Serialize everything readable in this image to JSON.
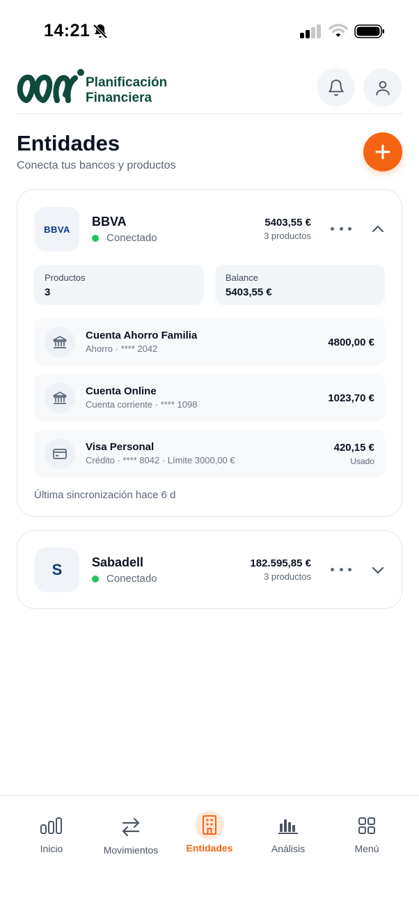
{
  "status_bar": {
    "time": "14:21"
  },
  "header": {
    "app_name_line1": "Planificación",
    "app_name_line2": "Financiera",
    "brand_color": "#0f4a3c"
  },
  "page": {
    "title": "Entidades",
    "subtitle": "Conecta tus bancos y productos",
    "accent_color": "#f56412"
  },
  "banks": [
    {
      "logo_text": "BBVA",
      "name": "BBVA",
      "status": "Conectado",
      "total": "5403,55 €",
      "count": "3 productos",
      "expanded": true,
      "stats": {
        "products_label": "Productos",
        "products_value": "3",
        "balance_label": "Balance",
        "balance_value": "5403,55 €"
      },
      "products": [
        {
          "icon": "bank-icon",
          "name": "Cuenta Ahorro Familia",
          "sub": "Ahorro · **** 2042",
          "amount": "4800,00 €"
        },
        {
          "icon": "bank-icon",
          "name": "Cuenta Online",
          "sub": "Cuenta corriente · **** 1098",
          "amount": "1023,70 €"
        },
        {
          "icon": "credit-card-icon",
          "name": "Visa Personal",
          "sub": "Crédito · **** 8042 · Límite 3000,00 €",
          "amount": "420,15 €",
          "note": "Usado"
        }
      ],
      "sync": "Última sincronización hace 6 d"
    },
    {
      "logo_text": "S",
      "name": "Sabadell",
      "status": "Conectado",
      "total": "182.595,85 €",
      "count": "3 productos",
      "expanded": false
    }
  ],
  "nav": [
    {
      "label": "Inicio",
      "icon": "home-bars-icon",
      "active": false
    },
    {
      "label": "Movimientos",
      "icon": "transfer-arrows-icon",
      "active": false
    },
    {
      "label": "Entidades",
      "icon": "building-icon",
      "active": true
    },
    {
      "label": "Análisis",
      "icon": "bar-chart-icon",
      "active": false
    },
    {
      "label": "Menú",
      "icon": "grid-icon",
      "active": false
    }
  ]
}
